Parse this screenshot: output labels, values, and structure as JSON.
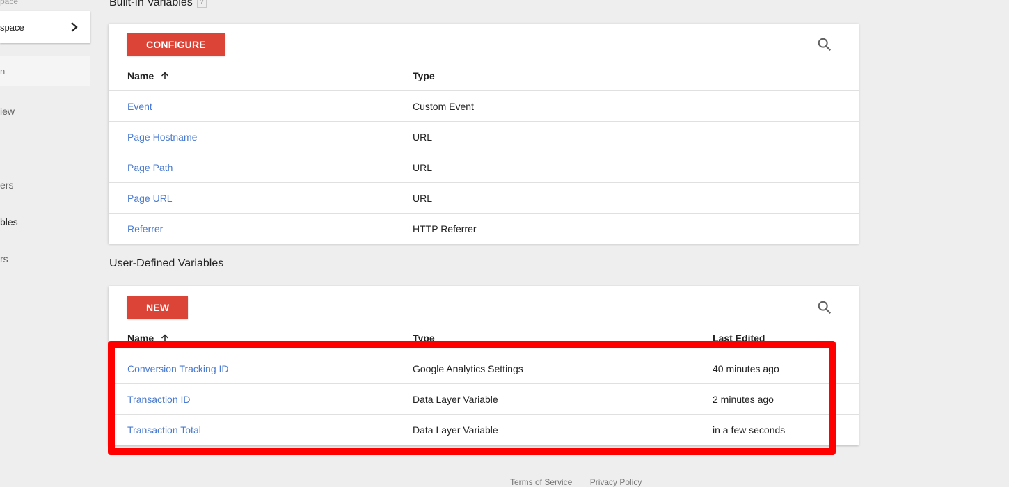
{
  "sidebar": {
    "workspace_label": "pace",
    "workspace_name": "space",
    "search_text": "n",
    "items": [
      {
        "label": "iew"
      },
      {
        "label": "ers"
      },
      {
        "label": "bles"
      },
      {
        "label": "rs"
      }
    ]
  },
  "builtin": {
    "title": "Built-In Variables",
    "help": "?",
    "configure_label": "CONFIGURE",
    "columns": {
      "name": "Name",
      "type": "Type"
    },
    "rows": [
      {
        "name": "Event",
        "type": "Custom Event"
      },
      {
        "name": "Page Hostname",
        "type": "URL"
      },
      {
        "name": "Page Path",
        "type": "URL"
      },
      {
        "name": "Page URL",
        "type": "URL"
      },
      {
        "name": "Referrer",
        "type": "HTTP Referrer"
      }
    ]
  },
  "userdefined": {
    "title": "User-Defined Variables",
    "new_label": "NEW",
    "columns": {
      "name": "Name",
      "type": "Type",
      "last_edited": "Last Edited"
    },
    "rows": [
      {
        "name": "Conversion Tracking ID",
        "type": "Google Analytics Settings",
        "last_edited": "40 minutes ago"
      },
      {
        "name": "Transaction ID",
        "type": "Data Layer Variable",
        "last_edited": "2 minutes ago"
      },
      {
        "name": "Transaction Total",
        "type": "Data Layer Variable",
        "last_edited": "in a few seconds"
      }
    ]
  },
  "footer": {
    "terms": "Terms of Service",
    "privacy": "Privacy Policy"
  },
  "colors": {
    "accent_red": "#db4437",
    "link_blue": "#4a7bd0",
    "highlight": "#ff0000"
  }
}
